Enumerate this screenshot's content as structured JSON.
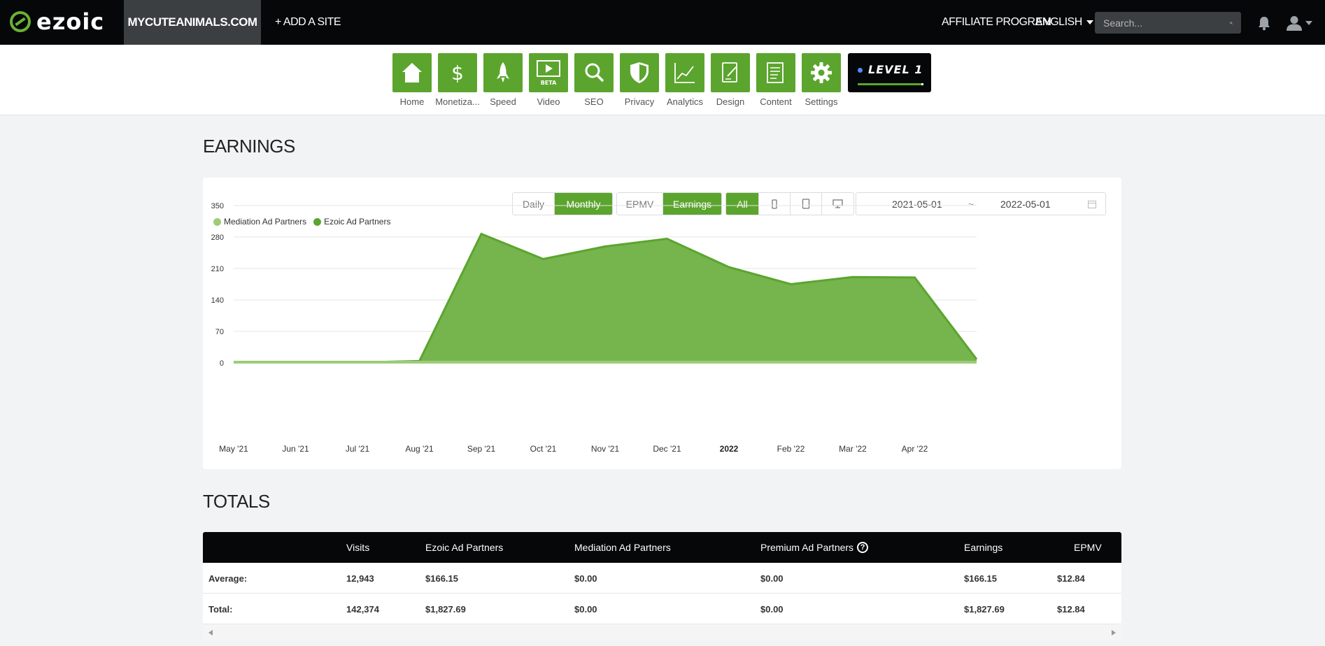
{
  "header": {
    "logo_text": "ezoic",
    "site_name": "MYCUTEANIMALS.COM",
    "add_site": "+ ADD A SITE",
    "affiliate": "AFFILIATE PROGRAM",
    "language": "ENGLISH",
    "search_placeholder": "Search..."
  },
  "apps": [
    {
      "label": "Home",
      "icon": "home-icon"
    },
    {
      "label": "Monetiza...",
      "icon": "dollar-icon"
    },
    {
      "label": "Speed",
      "icon": "rocket-icon"
    },
    {
      "label": "Video",
      "icon": "video-icon",
      "badge": "BETA"
    },
    {
      "label": "SEO",
      "icon": "magnifier-icon"
    },
    {
      "label": "Privacy",
      "icon": "shield-icon"
    },
    {
      "label": "Analytics",
      "icon": "line-chart-icon"
    },
    {
      "label": "Design",
      "icon": "design-icon"
    },
    {
      "label": "Content",
      "icon": "document-icon"
    },
    {
      "label": "Settings",
      "icon": "gear-icon"
    }
  ],
  "level": {
    "label": "LEVEL 1"
  },
  "earnings": {
    "title": "EARNINGS",
    "period_buttons": [
      "Daily",
      "Monthly"
    ],
    "period_active": "Monthly",
    "metric_buttons": [
      "EPMV",
      "Earnings"
    ],
    "metric_active": "Earnings",
    "device_buttons": {
      "all": "All"
    },
    "date_start": "2021-05-01",
    "date_sep": "~",
    "date_end": "2022-05-01"
  },
  "chart_data": {
    "type": "area",
    "title": "",
    "xlabel": "",
    "ylabel": "",
    "ylim": [
      0,
      350
    ],
    "yticks": [
      0,
      70,
      140,
      210,
      280,
      350
    ],
    "grid": true,
    "legend_position": "top-left",
    "x_tick_labels": [
      "May '21",
      "Jun '21",
      "Jul '21",
      "Aug '21",
      "Sep '21",
      "Oct '21",
      "Nov '21",
      "Dec '21",
      "2022",
      "Feb '22",
      "Mar '22",
      "Apr '22"
    ],
    "x_points": [
      "May '21",
      "Jun '21",
      "Jul '21",
      "Aug '21",
      "Sep '21",
      "Oct '21",
      "Nov '21",
      "Dec '21",
      "2022",
      "Feb '22",
      "Mar '22",
      "Apr '22",
      "May '22"
    ],
    "series": [
      {
        "name": "Mediation Ad Partners",
        "color": "#9ccc7a",
        "values": [
          0,
          0,
          0,
          0,
          0,
          0,
          0,
          0,
          0,
          0,
          0,
          0,
          0
        ]
      },
      {
        "name": "Ezoic Ad Partners",
        "color": "#5ba52e",
        "values": [
          1,
          1,
          1,
          4,
          287,
          231,
          259,
          276,
          213,
          175,
          191,
          190,
          8
        ]
      }
    ]
  },
  "totals": {
    "title": "TOTALS",
    "columns": [
      "Visits",
      "Ezoic Ad Partners",
      "Mediation Ad Partners",
      "Premium Ad Partners",
      "Earnings",
      "EPMV"
    ],
    "rows": [
      {
        "label": "Average:",
        "cells": [
          "12,943",
          "$166.15",
          "$0.00",
          "$0.00",
          "$166.15",
          "$12.84"
        ]
      },
      {
        "label": "Total:",
        "cells": [
          "142,374",
          "$1,827.69",
          "$0.00",
          "$0.00",
          "$1,827.69",
          "$12.84"
        ]
      }
    ]
  },
  "colors": {
    "brand_green": "#5ba52e",
    "topbar_bg": "#050708",
    "active_site_bg": "#3b3f42"
  }
}
